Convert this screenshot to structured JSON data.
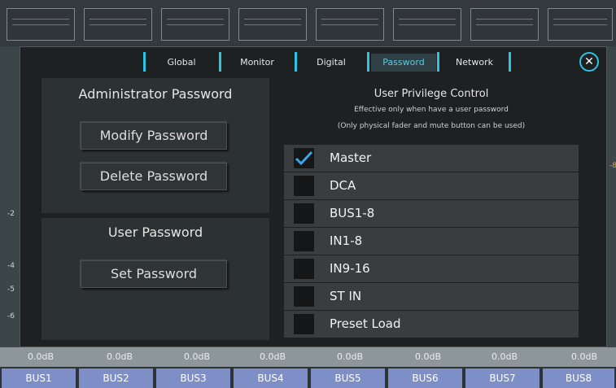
{
  "dialog": {
    "tabs": [
      {
        "label": "Global",
        "active": false
      },
      {
        "label": "Monitor",
        "active": false
      },
      {
        "label": "Digital",
        "active": false
      },
      {
        "label": "Password",
        "active": true
      },
      {
        "label": "Network",
        "active": false
      }
    ],
    "close_icon": "close-circle-icon"
  },
  "admin": {
    "title": "Administrator Password",
    "modify_label": "Modify Password",
    "delete_label": "Delete Password"
  },
  "user": {
    "title": "User Password",
    "set_label": "Set Password"
  },
  "privilege": {
    "title": "User Privilege Control",
    "note1": "Effective only when have a user password",
    "note2": "(Only physical fader and mute button can be used)",
    "items": [
      {
        "label": "Master",
        "checked": true
      },
      {
        "label": "DCA",
        "checked": false
      },
      {
        "label": "BUS1-8",
        "checked": false
      },
      {
        "label": "IN1-8",
        "checked": false
      },
      {
        "label": "IN9-16",
        "checked": false
      },
      {
        "label": "ST IN",
        "checked": false
      },
      {
        "label": "Preset Load",
        "checked": false
      }
    ]
  },
  "mixer": {
    "fader_values": [
      "0.0dB",
      "0.0dB",
      "0.0dB",
      "0.0dB",
      "0.0dB",
      "0.0dB",
      "0.0dB",
      "0.0dB"
    ],
    "buses": [
      "BUS1",
      "BUS2",
      "BUS3",
      "BUS4",
      "BUS5",
      "BUS6",
      "BUS7",
      "BUS8"
    ],
    "scale_marks": [
      "-2",
      "-4",
      "-5",
      "-6"
    ],
    "right_mark": "-8"
  },
  "colors": {
    "accent": "#2ec4e6",
    "bus_tab": "#7e8fc7",
    "dialog_bg": "#1e2122",
    "check": "#3aa6e8"
  }
}
